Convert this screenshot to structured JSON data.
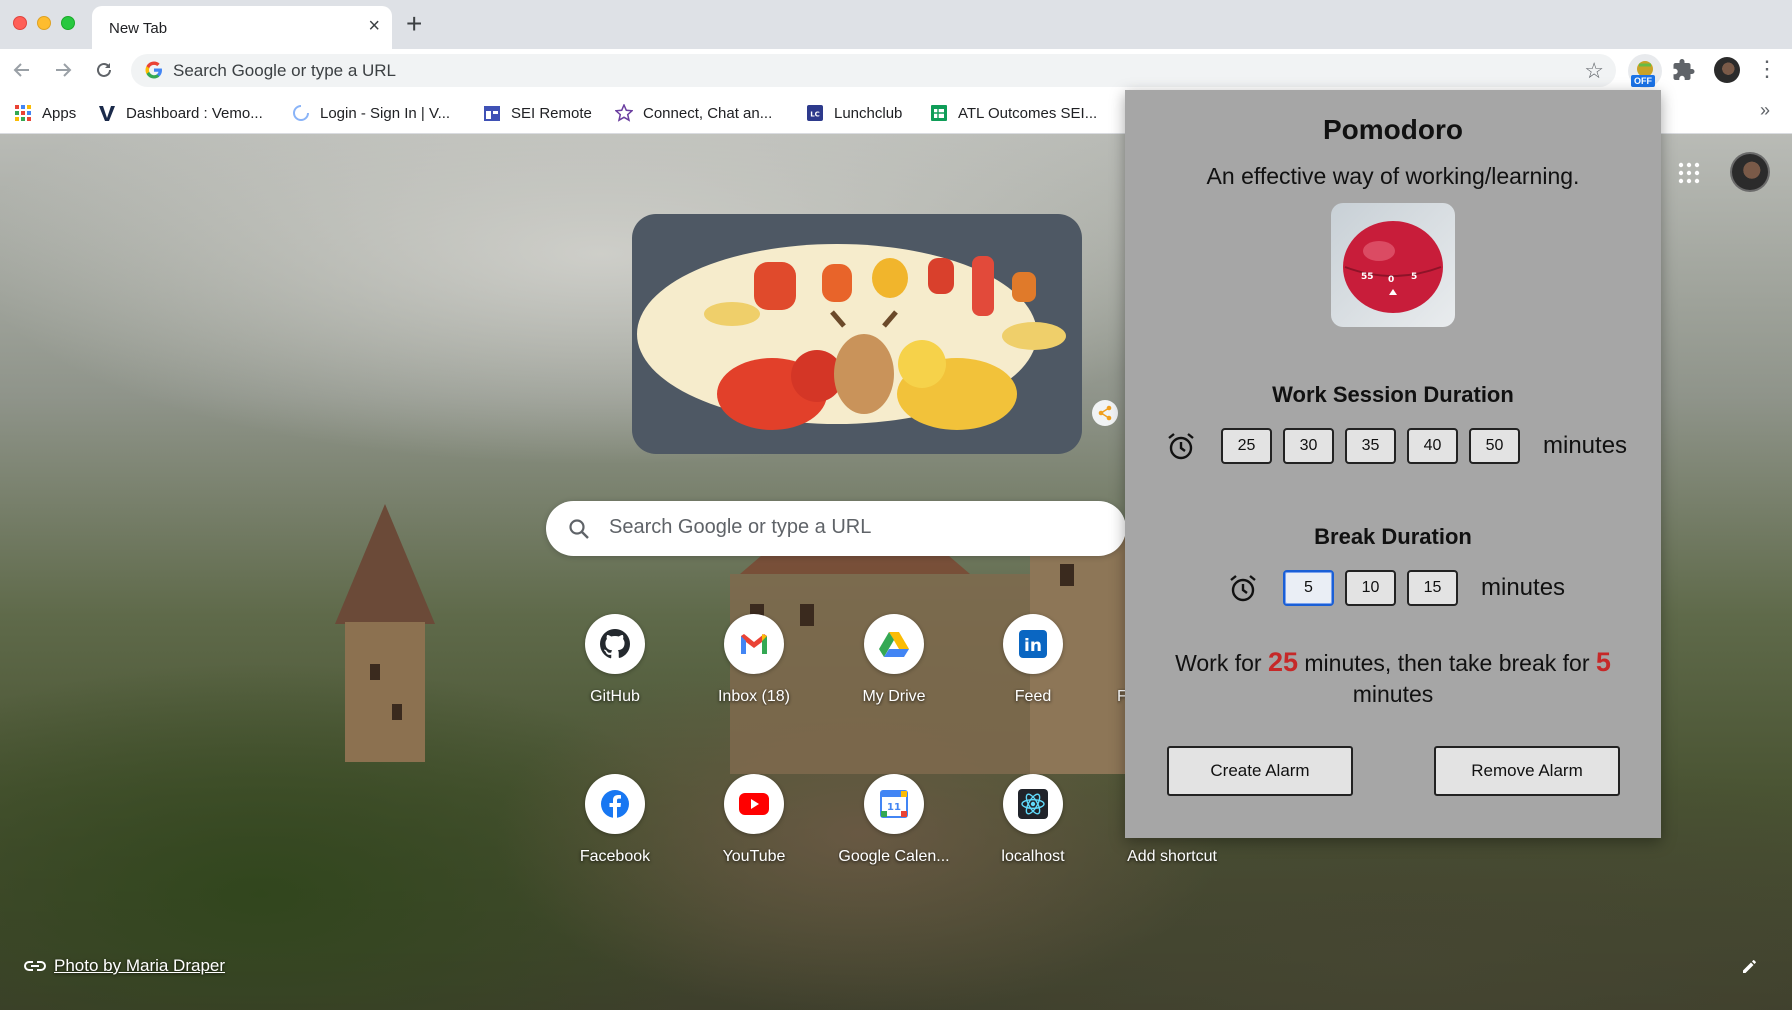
{
  "browser": {
    "tab_title": "New Tab",
    "tab_close_icon": "×",
    "new_tab_icon": "+",
    "omnibox_placeholder": "Search Google or type a URL",
    "extension_badge": "OFF"
  },
  "bookmarks": [
    {
      "label": "Apps",
      "icon": "apps-grid-icon"
    },
    {
      "label": "Dashboard : Vemo...",
      "icon": "vemo-icon"
    },
    {
      "label": "Login - Sign In | V...",
      "icon": "loading-icon"
    },
    {
      "label": "SEI Remote",
      "icon": "calendar-page-icon"
    },
    {
      "label": "Connect, Chat an...",
      "icon": "star-icon"
    },
    {
      "label": "Lunchclub",
      "icon": "lunchclub-icon"
    },
    {
      "label": "ATL Outcomes SEI...",
      "icon": "sheets-icon"
    }
  ],
  "ntp": {
    "search_placeholder": "Search Google or type a URL",
    "shortcuts_row1": [
      {
        "label": "GitHub",
        "icon": "github-icon"
      },
      {
        "label": "Inbox (18)",
        "icon": "gmail-icon"
      },
      {
        "label": "My Drive",
        "icon": "drive-icon"
      },
      {
        "label": "Feed",
        "icon": "linkedin-icon"
      },
      {
        "label": "F",
        "icon": "partial-tile"
      }
    ],
    "shortcuts_row2": [
      {
        "label": "Facebook",
        "icon": "facebook-icon"
      },
      {
        "label": "YouTube",
        "icon": "youtube-icon"
      },
      {
        "label": "Google Calen...",
        "icon": "calendar-icon"
      },
      {
        "label": "localhost",
        "icon": "react-icon"
      },
      {
        "label": "Add shortcut",
        "icon": "add-icon"
      }
    ],
    "photo_credit": "Photo by Maria Draper",
    "calendar_day": "11",
    "linkedin_text": "in"
  },
  "pomodoro": {
    "title": "Pomodoro",
    "subtitle": "An effective way of working/learning.",
    "work_title": "Work Session Duration",
    "work_options": [
      "25",
      "30",
      "35",
      "40",
      "50"
    ],
    "break_title": "Break Duration",
    "break_options": [
      "5",
      "10",
      "15"
    ],
    "selected_break": "5",
    "unit": "minutes",
    "summary": {
      "prefix": "Work for ",
      "work_value": "25",
      "middle": " minutes, then take break for ",
      "break_value": "5",
      "suffix": " minutes"
    },
    "create_label": "Create Alarm",
    "remove_label": "Remove Alarm",
    "timer_labels": [
      "55",
      "0",
      "5"
    ]
  },
  "colors": {
    "popup_bg": "#a6a6a6",
    "summary_accent": "#c62828",
    "selected_outline": "#1a5fd6"
  }
}
